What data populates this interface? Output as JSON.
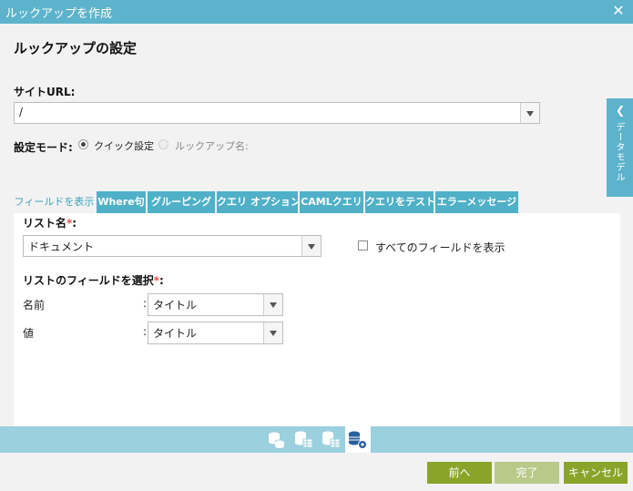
{
  "window": {
    "title": "ルックアップを作成"
  },
  "section_title": "ルックアップの設定",
  "site_url": {
    "label": "サイトURL:",
    "value": "/"
  },
  "settings_mode": {
    "label": "設定モード:",
    "options": [
      {
        "label": "クイック設定",
        "selected": true,
        "enabled": true
      },
      {
        "label": "ルックアップ名:",
        "selected": false,
        "enabled": false
      }
    ]
  },
  "tabs": [
    {
      "label": "フィールドを表示",
      "active": true
    },
    {
      "label": "Where句",
      "active": false
    },
    {
      "label": "グルーピング",
      "active": false
    },
    {
      "label": "クエリ オプション",
      "active": false
    },
    {
      "label": "CAMLクエリ",
      "active": false
    },
    {
      "label": "クエリをテスト",
      "active": false
    },
    {
      "label": "エラーメッセージ",
      "active": false
    }
  ],
  "list_name": {
    "label": "リスト名",
    "required_mark": "*",
    "colon": ":",
    "value": "ドキュメント"
  },
  "show_all_fields": {
    "label": "すべてのフィールドを表示",
    "checked": false
  },
  "list_fields": {
    "label": "リストのフィールドを選択",
    "required_mark": "*",
    "colon": ":",
    "rows": [
      {
        "label": "名前",
        "sep": ":",
        "value": "タイトル"
      },
      {
        "label": "値",
        "sep": ":",
        "value": "タイトル"
      }
    ]
  },
  "side_panel": {
    "label": "データモデル"
  },
  "footer": {
    "prev": "前へ",
    "done": "完了",
    "cancel": "キャンセル"
  },
  "colors": {
    "header": "#5db3cb",
    "tab": "#4fb0c7",
    "button": "#8aa42a",
    "button_disabled": "#b9c98a"
  }
}
